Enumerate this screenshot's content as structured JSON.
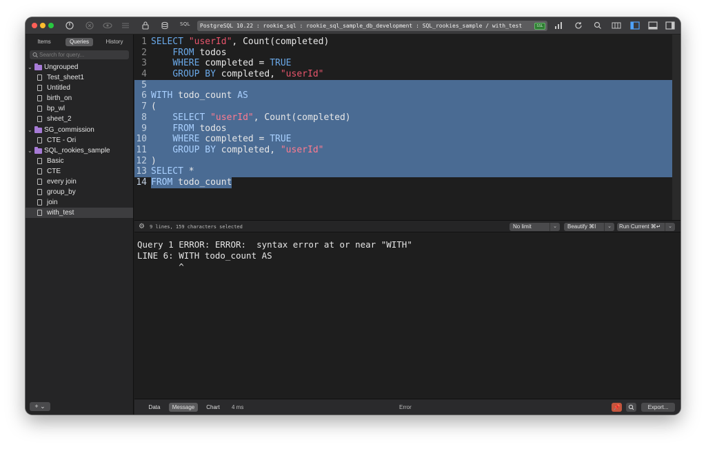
{
  "window": {
    "connection": "PostgreSQL 10.22 : rookie_sql : rookie_sql_sample_db_development : SQL_rookies_sample / with_test",
    "connection_badge": "SSL",
    "sql_label": "SQL"
  },
  "colors": {
    "keyword": "#6aa9e9",
    "string": "#e8556c",
    "selection": "#4a6b93",
    "folder": "#a77bd6",
    "pin": "#c4553d"
  },
  "sidebar": {
    "tabs": [
      "Items",
      "Queries",
      "History"
    ],
    "active_tab": "Queries",
    "search_placeholder": "Search for query...",
    "tree": [
      {
        "type": "folder",
        "label": "Ungrouped"
      },
      {
        "type": "file",
        "label": "Test_sheet1"
      },
      {
        "type": "file",
        "label": "Untitled"
      },
      {
        "type": "file",
        "label": "birth_on"
      },
      {
        "type": "file",
        "label": "bp_wl"
      },
      {
        "type": "file",
        "label": "sheet_2"
      },
      {
        "type": "folder",
        "label": "SG_commission"
      },
      {
        "type": "file",
        "label": "CTE - Ori"
      },
      {
        "type": "folder",
        "label": "SQL_rookies_sample"
      },
      {
        "type": "file",
        "label": "Basic"
      },
      {
        "type": "file",
        "label": "CTE"
      },
      {
        "type": "file",
        "label": "every join"
      },
      {
        "type": "file",
        "label": "group_by"
      },
      {
        "type": "file",
        "label": "join"
      },
      {
        "type": "file",
        "label": "with_test",
        "selected": true
      }
    ],
    "add_button": "+ ⌄"
  },
  "editor": {
    "lines": [
      {
        "n": "1",
        "tokens": [
          [
            "kw",
            "SELECT"
          ],
          [
            "t",
            " "
          ],
          [
            "str",
            "\"userId\""
          ],
          [
            "t",
            ", Count(completed)"
          ]
        ]
      },
      {
        "n": "2",
        "tokens": [
          [
            "t",
            "    "
          ],
          [
            "kw",
            "FROM"
          ],
          [
            "t",
            " todos"
          ]
        ]
      },
      {
        "n": "3",
        "tokens": [
          [
            "t",
            "    "
          ],
          [
            "kw",
            "WHERE"
          ],
          [
            "t",
            " completed = "
          ],
          [
            "kw",
            "TRUE"
          ]
        ]
      },
      {
        "n": "4",
        "tokens": [
          [
            "t",
            "    "
          ],
          [
            "kw",
            "GROUP BY"
          ],
          [
            "t",
            " completed, "
          ],
          [
            "str",
            "\"userId\""
          ]
        ]
      },
      {
        "n": "5",
        "tokens": [],
        "sel": true
      },
      {
        "n": "6",
        "tokens": [
          [
            "kw",
            "WITH"
          ],
          [
            "t",
            " todo_count "
          ],
          [
            "kw",
            "AS"
          ]
        ],
        "sel": true
      },
      {
        "n": "7",
        "tokens": [
          [
            "t",
            "("
          ]
        ],
        "sel": true
      },
      {
        "n": "8",
        "tokens": [
          [
            "t",
            "    "
          ],
          [
            "kw",
            "SELECT"
          ],
          [
            "t",
            " "
          ],
          [
            "str",
            "\"userId\""
          ],
          [
            "t",
            ", Count(completed)"
          ]
        ],
        "sel": true
      },
      {
        "n": "9",
        "tokens": [
          [
            "t",
            "    "
          ],
          [
            "kw",
            "FROM"
          ],
          [
            "t",
            " todos"
          ]
        ],
        "sel": true
      },
      {
        "n": "10",
        "tokens": [
          [
            "t",
            "    "
          ],
          [
            "kw",
            "WHERE"
          ],
          [
            "t",
            " completed = "
          ],
          [
            "kw",
            "TRUE"
          ]
        ],
        "sel": true
      },
      {
        "n": "11",
        "tokens": [
          [
            "t",
            "    "
          ],
          [
            "kw",
            "GROUP BY"
          ],
          [
            "t",
            " completed, "
          ],
          [
            "str",
            "\"userId\""
          ]
        ],
        "sel": true
      },
      {
        "n": "12",
        "tokens": [
          [
            "t",
            ")"
          ]
        ],
        "sel": true
      },
      {
        "n": "13",
        "tokens": [
          [
            "kw",
            "SELECT"
          ],
          [
            "t",
            " *"
          ]
        ],
        "sel": true
      },
      {
        "n": "14",
        "tokens": [
          [
            "kw",
            "FROM"
          ],
          [
            "t",
            " todo_count"
          ]
        ],
        "sel": true,
        "last": true
      }
    ],
    "selection_info": "9 lines, 159 characters selected",
    "limit": "No limit",
    "beautify": "Beautify ⌘I",
    "run": "Run Current ⌘↵"
  },
  "result": {
    "line1": "Query 1 ERROR: ERROR:  syntax error at or near \"WITH\"",
    "line2": "LINE 6: WITH todo_count AS",
    "line3": "        ^"
  },
  "bottom": {
    "tabs": [
      "Data",
      "Message",
      "Chart"
    ],
    "active_tab": "Message",
    "duration": "4 ms",
    "status": "Error",
    "export": "Export..."
  }
}
